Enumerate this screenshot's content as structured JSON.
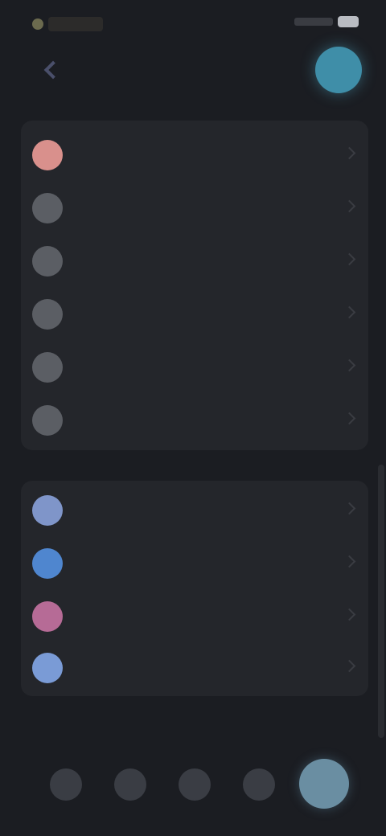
{
  "status_bar": {
    "time": "",
    "battery_icon": "battery-icon",
    "signal_icon": "signal-icon"
  },
  "header": {
    "title": "",
    "back_icon": "back-arrow-icon",
    "avatar_color": "#3f8ea8"
  },
  "card1": {
    "items": [
      {
        "label": "",
        "icon_color": "#d9908c",
        "icon": "profile-avatar"
      },
      {
        "label": "",
        "icon_color": "#5b5e64",
        "icon": "settings-item-icon"
      },
      {
        "label": "",
        "icon_color": "#5b5e64",
        "icon": "settings-item-icon"
      },
      {
        "label": "",
        "icon_color": "#5b5e64",
        "icon": "settings-item-icon"
      },
      {
        "label": "",
        "icon_color": "#5b5e64",
        "icon": "settings-item-icon"
      },
      {
        "label": "",
        "icon_color": "#5b5e64",
        "icon": "settings-item-icon"
      }
    ]
  },
  "card2": {
    "items": [
      {
        "label": "",
        "icon_color": "#7f95c9",
        "icon": "settings-item-icon"
      },
      {
        "label": "",
        "icon_color": "#4f86cf",
        "icon": "settings-item-icon"
      },
      {
        "label": "",
        "icon_color": "#b66b96",
        "icon": "settings-item-icon"
      },
      {
        "label": "",
        "icon_color": "#7a9bd6",
        "icon": "settings-item-icon"
      }
    ]
  },
  "tabbar": {
    "tabs": [
      {
        "icon": "tab-1-icon",
        "active": false
      },
      {
        "icon": "tab-2-icon",
        "active": false
      },
      {
        "icon": "tab-3-icon",
        "active": false
      },
      {
        "icon": "tab-4-icon",
        "active": false
      },
      {
        "icon": "tab-5-icon",
        "active": true
      }
    ],
    "accent": "#6a8ea2"
  }
}
